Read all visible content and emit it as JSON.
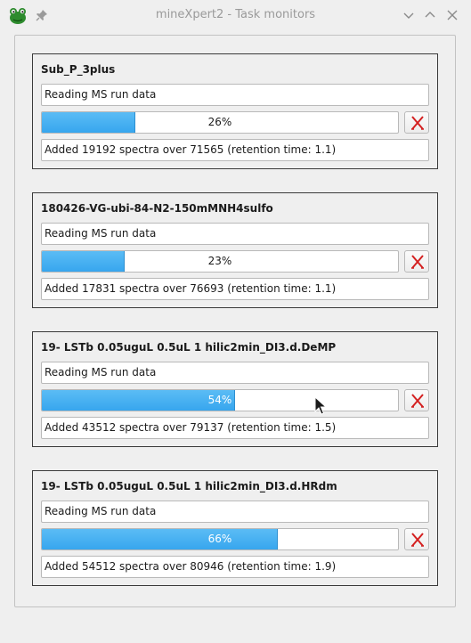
{
  "window": {
    "title": "mineXpert2 - Task monitors"
  },
  "monitors": [
    {
      "name": "Sub_P_3plus",
      "status": "Reading MS run data",
      "progress_percent": 26,
      "progress_label": "26%",
      "details": "Added 19192 spectra over 71565 (retention time: 1.1)"
    },
    {
      "name": "180426-VG-ubi-84-N2-150mMNH4sulfo",
      "status": "Reading MS run data",
      "progress_percent": 23,
      "progress_label": "23%",
      "details": "Added 17831 spectra over 76693 (retention time: 1.1)"
    },
    {
      "name": "19- LSTb 0.05uguL 0.5uL 1 hilic2min_DI3.d.DeMP",
      "status": "Reading MS run data",
      "progress_percent": 54,
      "progress_label": "54%",
      "details": "Added 43512 spectra over 79137 (retention time: 1.5)"
    },
    {
      "name": "19- LSTb 0.05uguL 0.5uL 1 hilic2min_DI3.d.HRdm",
      "status": "Reading MS run data",
      "progress_percent": 66,
      "progress_label": "66%",
      "details": "Added 54512 spectra over 80946 (retention time: 1.9)"
    }
  ],
  "icons": {
    "app": "frog-app-icon",
    "pin": "pin-icon",
    "minimize": "chevron-down-icon",
    "maximize": "chevron-up-icon",
    "close": "close-icon",
    "cancel": "cancel-task-icon"
  },
  "colors": {
    "progress_fill": "#3aa8ef",
    "cancel_icon": "#d42020"
  }
}
